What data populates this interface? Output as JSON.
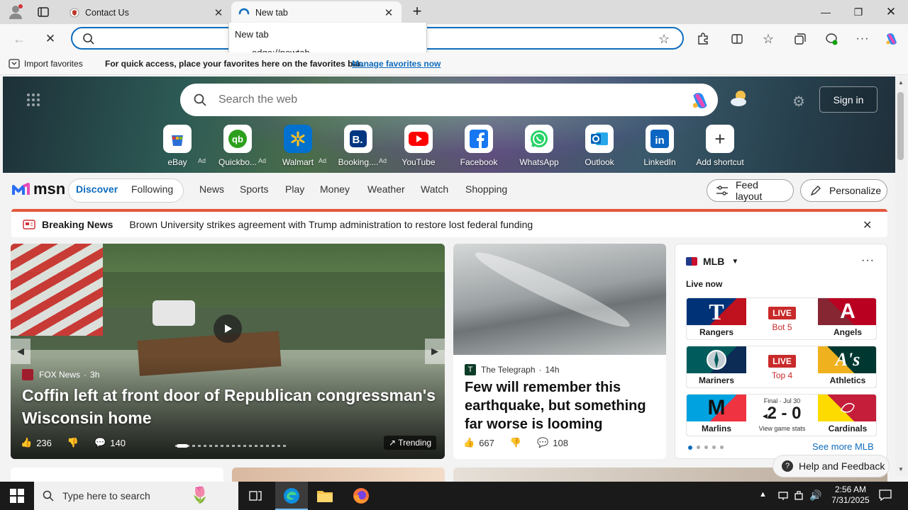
{
  "browser": {
    "tabs": [
      {
        "title": "Contact Us"
      },
      {
        "title": "New tab"
      }
    ],
    "address": {
      "value": ""
    },
    "omnibox": {
      "heading": "New tab",
      "suggestion": "edge://newtab"
    },
    "favorites_bar": {
      "import_label": "Import favorites",
      "prompt": "For quick access, place your favorites here on the favorites bar.",
      "manage_link": "Manage favorites now"
    }
  },
  "newtab": {
    "search_placeholder": "Search the web",
    "sign_in": "Sign in",
    "tiles": [
      {
        "label": "eBay",
        "ad": "Ad"
      },
      {
        "label": "Quickbo...",
        "ad": "Ad"
      },
      {
        "label": "Walmart",
        "ad": "Ad"
      },
      {
        "label": "Booking....",
        "ad": "Ad"
      },
      {
        "label": "YouTube",
        "ad": ""
      },
      {
        "label": "Facebook",
        "ad": ""
      },
      {
        "label": "WhatsApp",
        "ad": ""
      },
      {
        "label": "Outlook",
        "ad": ""
      },
      {
        "label": "LinkedIn",
        "ad": ""
      },
      {
        "label": "Add shortcut",
        "ad": ""
      }
    ]
  },
  "msn": {
    "logo": "msn",
    "nav": {
      "discover": "Discover",
      "following": "Following",
      "links": [
        "News",
        "Sports",
        "Play",
        "Money",
        "Weather",
        "Watch",
        "Shopping"
      ],
      "feed_layout": "Feed layout",
      "personalize": "Personalize"
    },
    "breaking": {
      "label": "Breaking News",
      "headline": "Brown University strikes agreement with Trump administration to restore lost federal funding"
    },
    "card1": {
      "source": "FOX News",
      "age": "3h",
      "title": "Coffin left at front door of Republican congressman's Wisconsin home",
      "likes": "236",
      "comments": "140",
      "trending": "Trending"
    },
    "card2": {
      "source": "The Telegraph",
      "age": "14h",
      "title": "Few will remember this earthquake, but something far worse is looming",
      "likes": "667",
      "comments": "108"
    },
    "mlb": {
      "title": "MLB",
      "live_now": "Live now",
      "games": [
        {
          "home": "Rangers",
          "away": "Angels",
          "status": "LIVE",
          "detail": "Bot 5"
        },
        {
          "home": "Mariners",
          "away": "Athletics",
          "status": "LIVE",
          "detail": "Top 4"
        },
        {
          "home": "Marlins",
          "away": "Cardinals",
          "final": "Final · Jul 30",
          "score": "2 - 0",
          "stats": "View game stats"
        }
      ],
      "see_more": "See more MLB",
      "help": "Help and Feedback"
    }
  },
  "taskbar": {
    "search_placeholder": "Type here to search",
    "time": "2:56 AM",
    "date": "7/31/2025"
  }
}
